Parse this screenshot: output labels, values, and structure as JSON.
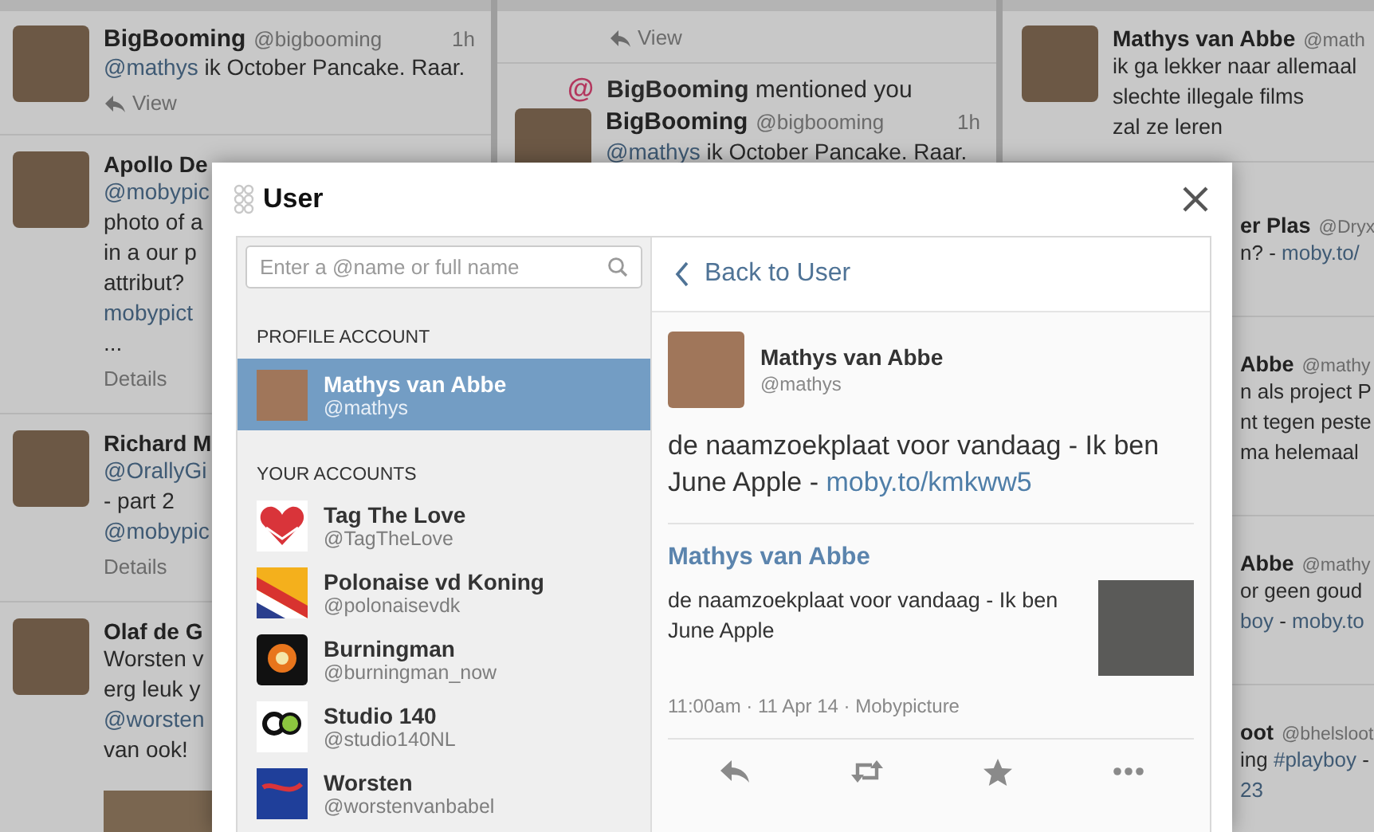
{
  "columns": [
    {
      "items": [
        {
          "kind": "tweet",
          "name": "BigBooming",
          "handle": "@bigbooming",
          "time": "1h",
          "lines": [
            [
              {
                "text": "@mathys",
                "link": true
              },
              {
                "text": " ik October Pancake. Raar."
              }
            ]
          ],
          "action": {
            "label": "View",
            "kind": "view"
          }
        },
        {
          "kind": "partial",
          "name": "Apollo De",
          "lines": [
            [
              {
                "text": "@mobypic",
                "link": true
              }
            ],
            [
              {
                "text": "photo of a"
              }
            ],
            [
              {
                "text": "in a our p"
              }
            ],
            [
              {
                "text": "attribut?"
              }
            ],
            [
              {
                "text": "mobypict",
                "link": true
              }
            ],
            [
              {
                "text": "..."
              }
            ]
          ],
          "action": {
            "label": "Details",
            "kind": "details"
          }
        },
        {
          "kind": "partial",
          "name": "Richard M",
          "lines": [
            [
              {
                "text": "@OrallyGi",
                "link": true
              }
            ],
            [
              {
                "text": "- part 2"
              }
            ],
            [
              {
                "text": "@mobypic",
                "link": true
              }
            ]
          ],
          "action": {
            "label": "Details",
            "kind": "details"
          }
        },
        {
          "kind": "partial",
          "name": "Olaf de G",
          "lines": [
            [
              {
                "text": "Worsten v"
              }
            ],
            [
              {
                "text": "erg leuk y"
              }
            ],
            [
              {
                "text": "@worsten",
                "link": true
              }
            ],
            [
              {
                "text": "van ook!"
              }
            ]
          ],
          "has_photo": true
        }
      ]
    },
    {
      "items": [
        {
          "kind": "tail",
          "action": {
            "label": "View",
            "kind": "view"
          }
        },
        {
          "kind": "mention",
          "icon": "@",
          "text": "**BigBooming** mentioned you",
          "name": "BigBooming",
          "handle": "@bigbooming",
          "time": "1h",
          "lines": [
            [
              {
                "text": "@mathys",
                "link": true
              },
              {
                "text": " ik October Pancake. Raar."
              }
            ]
          ]
        }
      ]
    },
    {
      "items": [
        {
          "kind": "tweet",
          "name": "Mathys van Abbe",
          "handle": "@math",
          "lines": [
            [
              {
                "text": "ik ga lekker naar allemaal"
              }
            ],
            [
              {
                "text": "slechte illegale films"
              }
            ],
            [
              {
                "text": "zal ze leren"
              }
            ]
          ]
        },
        {
          "kind": "fragment",
          "name": "er Plas",
          "handle": "@Dryx",
          "lines": [
            [
              {
                "text": "n? - "
              },
              {
                "text": "moby.to/",
                "link": true
              }
            ]
          ]
        },
        {
          "kind": "fragment",
          "name": "Abbe",
          "handle": "@mathy",
          "lines": [
            [
              {
                "text": "n als project P"
              }
            ],
            [
              {
                "text": "nt tegen peste"
              }
            ],
            [
              {
                "text": "ma helemaal"
              }
            ]
          ]
        },
        {
          "kind": "fragment",
          "name": "Abbe",
          "handle": "@mathy",
          "lines": [
            [
              {
                "text": "or geen goud"
              }
            ],
            [
              {
                "text": "boy",
                "link": true
              },
              {
                "text": " - "
              },
              {
                "text": "moby.to",
                "link": true
              }
            ]
          ]
        },
        {
          "kind": "fragment",
          "name": "oot",
          "handle": "@bhelsloot",
          "lines": [
            [
              {
                "text": "ing "
              },
              {
                "text": "#playboy",
                "link": true
              },
              {
                "text": " -"
              }
            ],
            [
              {
                "text": "23",
                "link": true
              }
            ]
          ]
        }
      ]
    }
  ],
  "modal": {
    "title": "User",
    "search": {
      "placeholder": "Enter a @name or full name"
    },
    "sections": [
      {
        "heading": "PROFILE ACCOUNT",
        "accounts": [
          {
            "name": "Mathys van Abbe",
            "handle": "@mathys",
            "kind": "photo",
            "selected": true
          }
        ]
      },
      {
        "heading": "YOUR ACCOUNTS",
        "accounts": [
          {
            "name": "Tag The Love",
            "handle": "@TagTheLove",
            "kind": "heart",
            "selected": false
          },
          {
            "name": "Polonaise vd Koning",
            "handle": "@polonaisevdk",
            "kind": "stripes",
            "selected": false
          },
          {
            "name": "Burningman",
            "handle": "@burningman_now",
            "kind": "burst",
            "selected": false
          },
          {
            "name": "Studio 140",
            "handle": "@studio140NL",
            "kind": "ring",
            "selected": false
          },
          {
            "name": "Worsten",
            "handle": "@worstenvanbabel",
            "kind": "blue",
            "selected": false
          }
        ]
      }
    ],
    "back": "Back to User",
    "tweet": {
      "name": "Mathys van Abbe",
      "handle": "@mathys",
      "text": [
        {
          "text": "de naamzoekplaat voor vandaag - Ik ben June Apple - "
        },
        {
          "text": "moby.to/kmkww5",
          "link": true
        }
      ],
      "card": {
        "title": "Mathys van Abbe",
        "text": "de naamzoekplaat voor vandaag - Ik ben June Apple"
      },
      "meta": "11:00am · 11 Apr 14 · Mobypicture"
    }
  }
}
